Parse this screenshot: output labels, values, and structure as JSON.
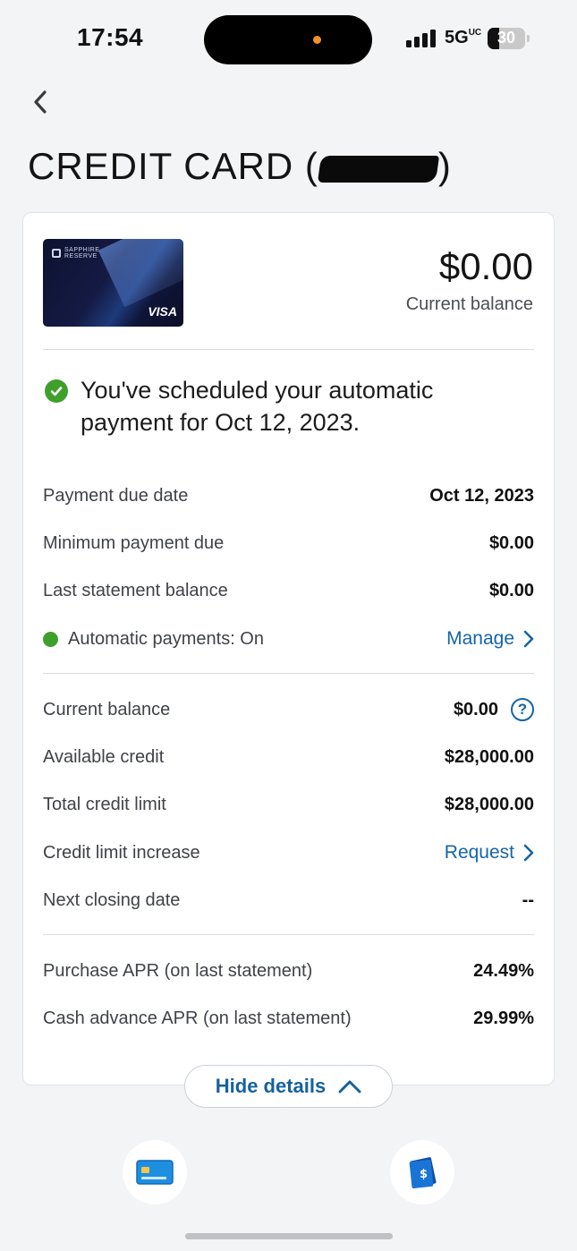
{
  "status_bar": {
    "time": "17:54",
    "network": "5G",
    "network_sub": "UC",
    "battery": "30",
    "battery_level": 0.3
  },
  "header": {
    "title_prefix": "CREDIT CARD (",
    "title_suffix": ")"
  },
  "card_image": {
    "brand": "SAPPHIRE",
    "tier": "RESERVE",
    "network": "VISA"
  },
  "balance": {
    "amount": "$0.00",
    "label": "Current balance"
  },
  "notice": {
    "text": "You've scheduled your automatic payment for Oct 12, 2023."
  },
  "payment_rows": [
    {
      "label": "Payment due date",
      "value": "Oct 12, 2023"
    },
    {
      "label": "Minimum payment due",
      "value": "$0.00"
    },
    {
      "label": "Last statement balance",
      "value": "$0.00"
    }
  ],
  "autopay": {
    "label": "Automatic payments: On",
    "link": "Manage"
  },
  "credit_rows": {
    "current_balance": {
      "label": "Current balance",
      "value": "$0.00"
    },
    "available_credit": {
      "label": "Available credit",
      "value": "$28,000.00"
    },
    "total_limit": {
      "label": "Total credit limit",
      "value": "$28,000.00"
    },
    "limit_increase": {
      "label": "Credit limit increase",
      "link": "Request"
    },
    "next_closing": {
      "label": "Next closing date",
      "value": "--"
    }
  },
  "apr_rows": [
    {
      "label": "Purchase APR (on last statement)",
      "value": "24.49%"
    },
    {
      "label": "Cash advance APR (on last statement)",
      "value": "29.99%"
    }
  ],
  "actions": {
    "hide_details": "Hide details"
  },
  "colors": {
    "accent": "#1565a7",
    "success": "#3ea02b",
    "background": "#f2f4f6"
  },
  "icons": [
    "chevron-left-icon",
    "check-circle-icon",
    "chevron-right-icon",
    "help-icon",
    "chevron-up-icon",
    "card-icon",
    "bill-pay-icon"
  ]
}
